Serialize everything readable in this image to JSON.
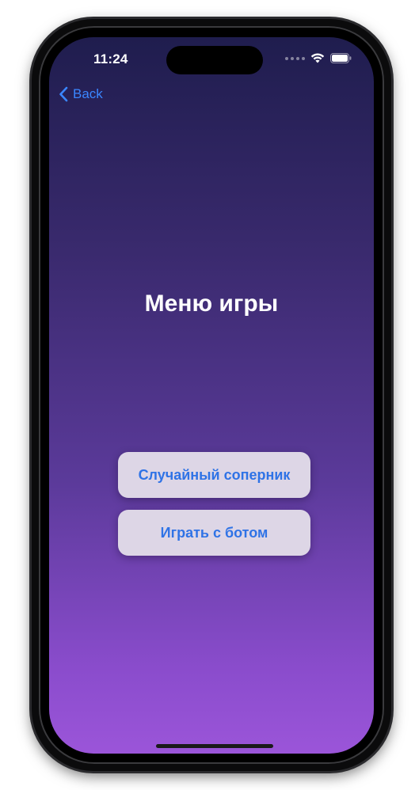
{
  "status_bar": {
    "time": "11:24"
  },
  "nav": {
    "back_label": "Back"
  },
  "main": {
    "title": "Меню игры",
    "buttons": [
      {
        "label": "Случайный соперник"
      },
      {
        "label": "Играть с ботом"
      }
    ]
  },
  "colors": {
    "accent": "#2f73e6",
    "back_link": "#3a86ff",
    "button_bg": "#ddd6e6",
    "gradient_top": "#1f1d4e",
    "gradient_bottom": "#9b55d9"
  },
  "icons": {
    "back": "chevron-left-icon",
    "wifi": "wifi-icon",
    "battery": "battery-icon",
    "cellular": "cellular-signal-icon"
  }
}
